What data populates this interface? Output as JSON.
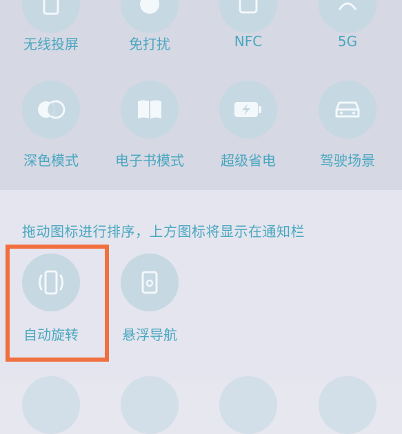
{
  "colors": {
    "accent": "#4aa7c0",
    "circle_bg": "#c6d8e2",
    "highlight": "#f16f3f",
    "top_panel_bg": "#d6d8e3",
    "bottom_panel_bg": "#e4e5ee"
  },
  "quick_settings": {
    "row1": [
      {
        "label": "无线投屏",
        "icon": "screen-cast-icon"
      },
      {
        "label": "免打扰",
        "icon": "moon-icon"
      },
      {
        "label": "NFC",
        "icon": "nfc-icon"
      },
      {
        "label": "5G",
        "icon": "5g-icon"
      }
    ],
    "row2": [
      {
        "label": "深色模式",
        "icon": "dark-mode-icon"
      },
      {
        "label": "电子书模式",
        "icon": "book-icon"
      },
      {
        "label": "超级省电",
        "icon": "battery-saver-icon"
      },
      {
        "label": "驾驶场景",
        "icon": "car-icon"
      }
    ]
  },
  "hint_text": "拖动图标进行排序，上方图标将显示在通知栏",
  "available": [
    {
      "label": "自动旋转",
      "icon": "auto-rotate-icon"
    },
    {
      "label": "悬浮导航",
      "icon": "floating-navigation-icon"
    }
  ]
}
